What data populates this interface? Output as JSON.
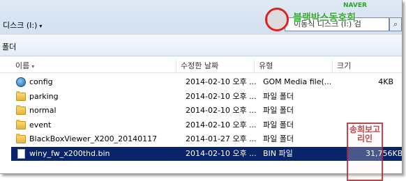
{
  "address": {
    "breadcrumb": "디스크 (I:)",
    "search_placeholder": "이동식 디스크 (I:) 검"
  },
  "toolbar": {
    "new_folder_label": "폴더"
  },
  "columns": {
    "name": "이름",
    "date": "수정한 날짜",
    "type": "유형",
    "size": "크기"
  },
  "files": [
    {
      "name": "config",
      "date": "2014-02-10 오후 ...",
      "type": "GOM Media file(...",
      "size": "4KB",
      "icon": "gom-media-icon"
    },
    {
      "name": "parking",
      "date": "2014-02-10 오후 ...",
      "type": "파일 폴더",
      "size": "",
      "icon": "folder-icon"
    },
    {
      "name": "normal",
      "date": "2014-02-10 오후 ...",
      "type": "파일 폴더",
      "size": "",
      "icon": "folder-icon"
    },
    {
      "name": "event",
      "date": "2014-02-10 오후 ...",
      "type": "파일 폴더",
      "size": "",
      "icon": "folder-icon"
    },
    {
      "name": "BlackBoxViewer_X200_20140117",
      "date": "2014-01-27 오후 ...",
      "type": "파일 폴더",
      "size": "",
      "icon": "folder-icon"
    },
    {
      "name": "winy_fw_x200thd.bin",
      "date": "2014-02-10 오후 ...",
      "type": "BIN 파일",
      "size": "31,756KB",
      "icon": "bin-file-icon",
      "selected": true
    }
  ],
  "watermark": {
    "brand": "NAVER",
    "title": "블랙박스동호회"
  },
  "stamp_text": "송희보고리인",
  "colors": {
    "selection": "#0a246a",
    "stamp": "#b3262e",
    "watermark_green": "#3aa83a"
  }
}
